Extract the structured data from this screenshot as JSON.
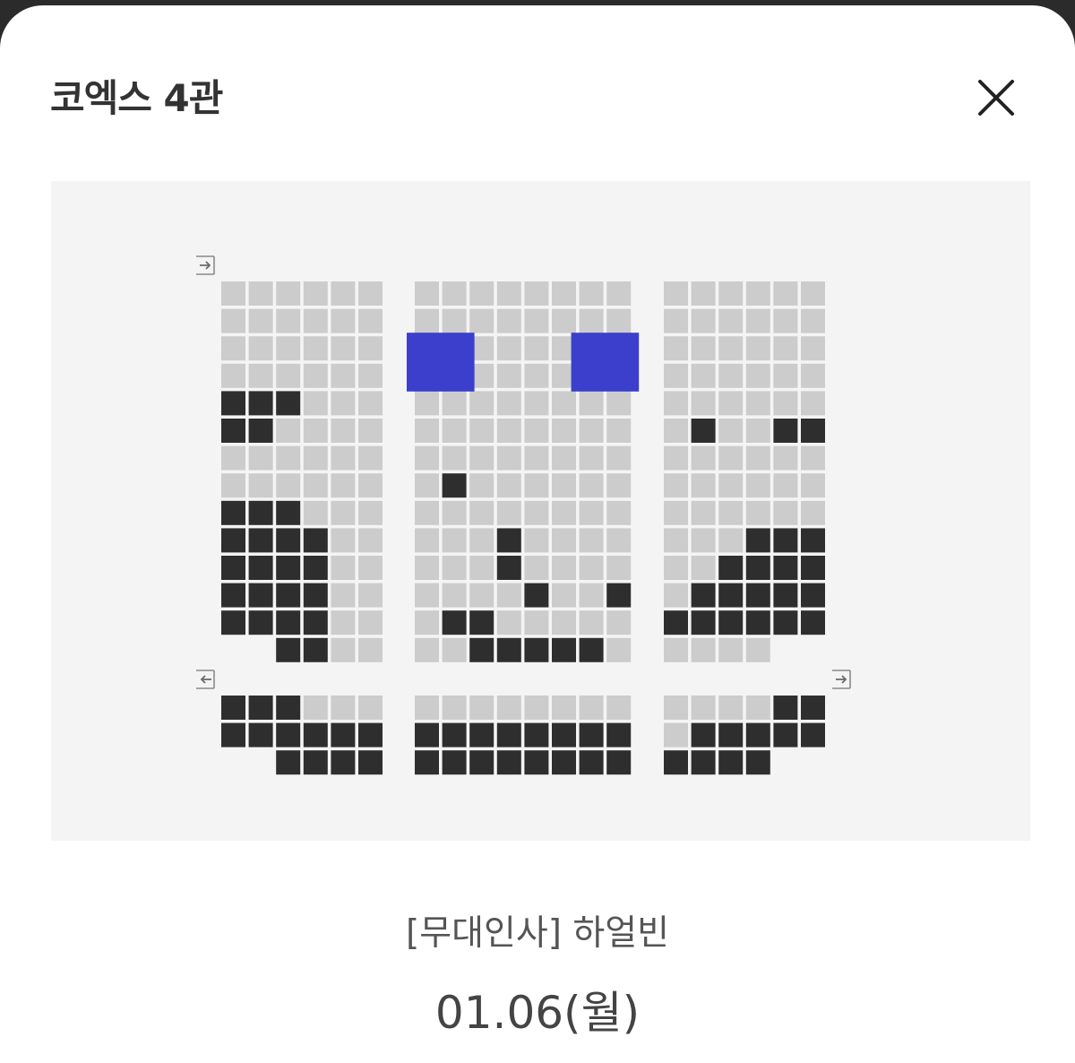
{
  "header": {
    "title": "코엑스 4관",
    "close_icon": "close-icon"
  },
  "colors": {
    "map_background": "#f4f4f4",
    "seat_available": "#cccccc",
    "seat_sold": "#2e2e2e",
    "seat_selected": "#3b3fcc"
  },
  "seat_map": {
    "exit_icons": [
      "exit-arrow-in-icon",
      "exit-arrow-out-icon",
      "exit-arrow-in-icon"
    ],
    "legend": {
      "o": "available",
      "x": "sold",
      "S": "selected"
    },
    "upper_rows": [
      {
        "left": "oooooo",
        "center": "oooooooo",
        "right": "oooooo"
      },
      {
        "left": "oooooo",
        "center": "oooooooo",
        "right": "oooooo"
      },
      {
        "left": "oooooo",
        "center": "SSooooSS",
        "right": "oooooo"
      },
      {
        "left": "oooooo",
        "center": "SSooooSS",
        "right": "oooooo"
      },
      {
        "left": "xxxooo",
        "center": "oooooooo",
        "right": "oooooo"
      },
      {
        "left": "xxoooo",
        "center": "oooooooo",
        "right": "oxooxx"
      },
      {
        "left": "oooooo",
        "center": "oooooooo",
        "right": "oooooo"
      },
      {
        "left": "oooooo",
        "center": "oxoooooo",
        "right": "oooooo"
      },
      {
        "left": "xxxooo",
        "center": "oooooooo",
        "right": "oooooo"
      },
      {
        "left": "xxxxoo",
        "center": "oooxoooo",
        "right": "oooxxx"
      },
      {
        "left": "xxxxoo",
        "center": "oooxoooo",
        "right": "ooxxxx"
      },
      {
        "left": "xxxxoo",
        "center": "ooooxoox",
        "right": "oxxxxx"
      },
      {
        "left": "xxxxoo",
        "center": "oxxooooo",
        "right": "xxxxxx"
      },
      {
        "left": "__xxoo",
        "center": "ooxxxxxo",
        "right": "oooo__"
      }
    ],
    "lower_rows": [
      {
        "left": "xxxooo",
        "center": "oooooooo",
        "right": "ooooxx"
      },
      {
        "left": "xxxxxx",
        "center": "xxxxxxxx",
        "right": "oxxxxx"
      },
      {
        "left": "__xxxx",
        "center": "xxxxxxxx",
        "right": "xxxx__"
      }
    ]
  },
  "info": {
    "movie": "[무대인사] 하얼빈",
    "date": "01.06(월)"
  }
}
